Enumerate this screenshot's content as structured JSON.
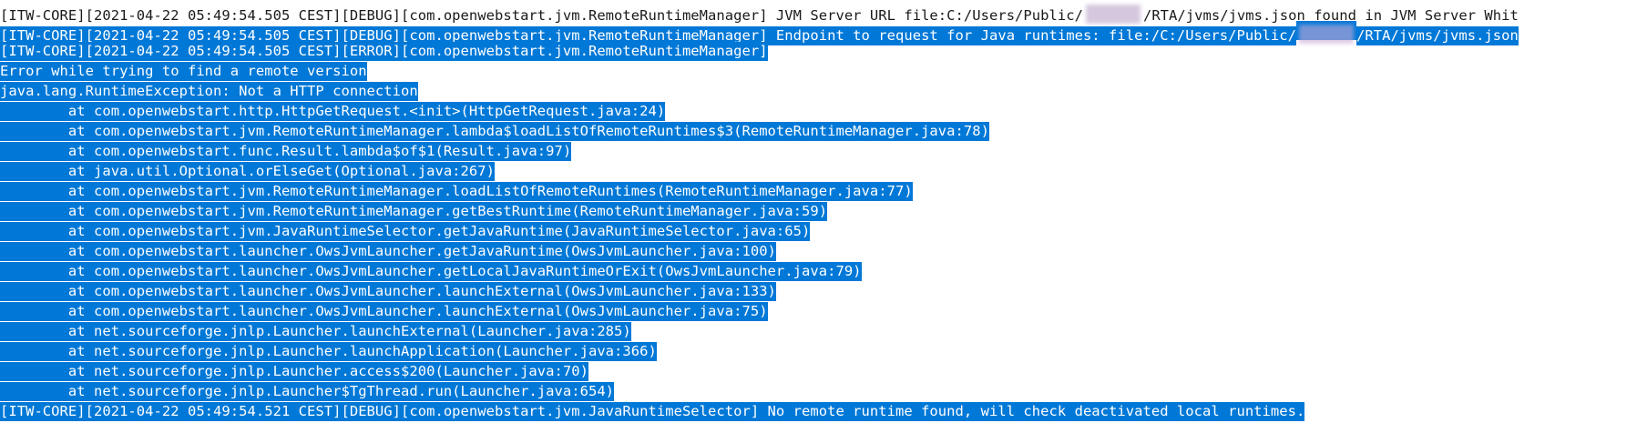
{
  "log": {
    "lines": [
      {
        "text": "[ITW-CORE][2021-04-22 05:49:54.505 CEST][DEBUG][com.openwebstart.jvm.RemoteRuntimeManager] JVM Server URL file:C:/Users/Public/",
        "tail": "/RTA/jvms/jvms.json found in JVM Server Whit",
        "selected": false,
        "redacted": true
      },
      {
        "text": "[ITW-CORE][2021-04-22 05:49:54.505 CEST][DEBUG][com.openwebstart.jvm.RemoteRuntimeManager] Endpoint to request for Java runtimes: file:/C:/Users/Public/",
        "tail": "/RTA/jvms/jvms.json",
        "selected": true,
        "redacted": true
      },
      {
        "text": "[ITW-CORE][2021-04-22 05:49:54.505 CEST][ERROR][com.openwebstart.jvm.RemoteRuntimeManager]",
        "selected": true
      },
      {
        "text": "Error while trying to find a remote version",
        "selected": true
      },
      {
        "text": "java.lang.RuntimeException: Not a HTTP connection",
        "selected": true
      },
      {
        "text": "        at com.openwebstart.http.HttpGetRequest.<init>(HttpGetRequest.java:24)",
        "selected": true
      },
      {
        "text": "        at com.openwebstart.jvm.RemoteRuntimeManager.lambda$loadListOfRemoteRuntimes$3(RemoteRuntimeManager.java:78)",
        "selected": true
      },
      {
        "text": "        at com.openwebstart.func.Result.lambda$of$1(Result.java:97)",
        "selected": true
      },
      {
        "text": "        at java.util.Optional.orElseGet(Optional.java:267)",
        "selected": true
      },
      {
        "text": "        at com.openwebstart.jvm.RemoteRuntimeManager.loadListOfRemoteRuntimes(RemoteRuntimeManager.java:77)",
        "selected": true
      },
      {
        "text": "        at com.openwebstart.jvm.RemoteRuntimeManager.getBestRuntime(RemoteRuntimeManager.java:59)",
        "selected": true
      },
      {
        "text": "        at com.openwebstart.jvm.JavaRuntimeSelector.getJavaRuntime(JavaRuntimeSelector.java:65)",
        "selected": true
      },
      {
        "text": "        at com.openwebstart.launcher.OwsJvmLauncher.getJavaRuntime(OwsJvmLauncher.java:100)",
        "selected": true
      },
      {
        "text": "        at com.openwebstart.launcher.OwsJvmLauncher.getLocalJavaRuntimeOrExit(OwsJvmLauncher.java:79)",
        "selected": true
      },
      {
        "text": "        at com.openwebstart.launcher.OwsJvmLauncher.launchExternal(OwsJvmLauncher.java:133)",
        "selected": true
      },
      {
        "text": "        at com.openwebstart.launcher.OwsJvmLauncher.launchExternal(OwsJvmLauncher.java:75)",
        "selected": true
      },
      {
        "text": "        at net.sourceforge.jnlp.Launcher.launchExternal(Launcher.java:285)",
        "selected": true
      },
      {
        "text": "        at net.sourceforge.jnlp.Launcher.launchApplication(Launcher.java:366)",
        "selected": true
      },
      {
        "text": "        at net.sourceforge.jnlp.Launcher.access$200(Launcher.java:70)",
        "selected": true
      },
      {
        "text": "        at net.sourceforge.jnlp.Launcher$TgThread.run(Launcher.java:654)",
        "selected": true
      },
      {
        "text": "[ITW-CORE][2021-04-22 05:49:54.521 CEST][DEBUG][com.openwebstart.jvm.JavaRuntimeSelector] No remote runtime found, will check deactivated local runtimes.",
        "selected": true
      }
    ],
    "colors": {
      "background": "#ffffff",
      "text": "#1a1a1a",
      "selection_background": "#0078d7",
      "selection_text": "#ffffff"
    }
  }
}
